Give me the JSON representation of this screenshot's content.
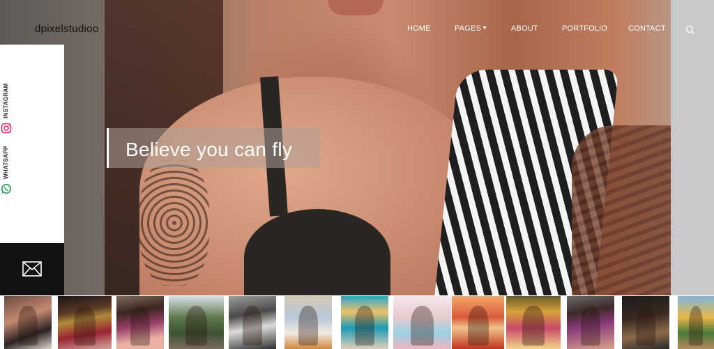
{
  "brand": {
    "name": "dpixelstudioo"
  },
  "nav": {
    "items": [
      {
        "label": "HOME"
      },
      {
        "label": "PAGES"
      },
      {
        "label": "ABOUT"
      },
      {
        "label": "PORTFOLIO"
      },
      {
        "label": "CONTACT"
      }
    ],
    "search_icon": "search-icon",
    "pages_dropdown_icon": "caret-down-icon"
  },
  "social": {
    "instagram_label": "INSTAGRAM",
    "whatsapp_label": "WHATSAPP",
    "instagram_icon": "instagram-icon",
    "whatsapp_icon": "whatsapp-icon",
    "mail_icon": "mail-icon",
    "instagram_color": "#e1306c",
    "whatsapp_color": "#1aa34a"
  },
  "hero": {
    "caption": "Believe you can fly"
  },
  "gallery": {
    "thumbnail_count": 13
  }
}
